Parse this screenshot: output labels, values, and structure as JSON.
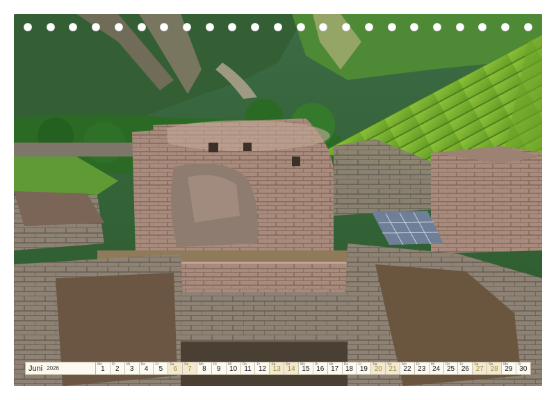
{
  "calendar": {
    "month": "Juni",
    "year": "2026",
    "days": [
      {
        "n": "1",
        "wd": "Mo",
        "weekend": false
      },
      {
        "n": "2",
        "wd": "Di",
        "weekend": false
      },
      {
        "n": "3",
        "wd": "Mi",
        "weekend": false
      },
      {
        "n": "4",
        "wd": "Do",
        "weekend": false
      },
      {
        "n": "5",
        "wd": "Fr",
        "weekend": false
      },
      {
        "n": "6",
        "wd": "Sa",
        "weekend": true
      },
      {
        "n": "7",
        "wd": "So",
        "weekend": true
      },
      {
        "n": "8",
        "wd": "Mo",
        "weekend": false
      },
      {
        "n": "9",
        "wd": "Di",
        "weekend": false
      },
      {
        "n": "10",
        "wd": "Mi",
        "weekend": false
      },
      {
        "n": "11",
        "wd": "Do",
        "weekend": false
      },
      {
        "n": "12",
        "wd": "Fr",
        "weekend": false
      },
      {
        "n": "13",
        "wd": "Sa",
        "weekend": true
      },
      {
        "n": "14",
        "wd": "So",
        "weekend": true
      },
      {
        "n": "15",
        "wd": "Mo",
        "weekend": false
      },
      {
        "n": "16",
        "wd": "Di",
        "weekend": false
      },
      {
        "n": "17",
        "wd": "Mi",
        "weekend": false
      },
      {
        "n": "18",
        "wd": "Do",
        "weekend": false
      },
      {
        "n": "19",
        "wd": "Fr",
        "weekend": false
      },
      {
        "n": "20",
        "wd": "Sa",
        "weekend": true
      },
      {
        "n": "21",
        "wd": "So",
        "weekend": true
      },
      {
        "n": "22",
        "wd": "Mo",
        "weekend": false
      },
      {
        "n": "23",
        "wd": "Di",
        "weekend": false
      },
      {
        "n": "24",
        "wd": "Mi",
        "weekend": false
      },
      {
        "n": "25",
        "wd": "Do",
        "weekend": false
      },
      {
        "n": "26",
        "wd": "Fr",
        "weekend": false
      },
      {
        "n": "27",
        "wd": "Sa",
        "weekend": true
      },
      {
        "n": "28",
        "wd": "So",
        "weekend": true
      },
      {
        "n": "29",
        "wd": "Mo",
        "weekend": false
      },
      {
        "n": "30",
        "wd": "Di",
        "weekend": false
      }
    ]
  },
  "binding_hole_count": 23,
  "colors": {
    "weekend_number": "#9a8a44",
    "calendar_bar_bg": "#fbf6ea",
    "forest_green": "#2f6b2a",
    "terrace_green": "#7fb52e",
    "stone": "#8a7a6a"
  }
}
